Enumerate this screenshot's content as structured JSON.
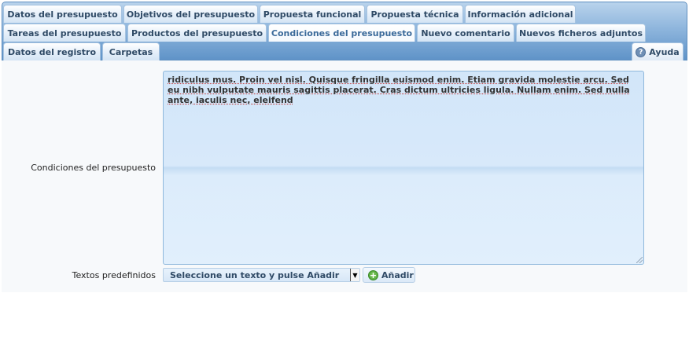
{
  "tabs": {
    "row1": [
      {
        "label": "Datos del presupuesto"
      },
      {
        "label": "Objetivos del presupuesto"
      },
      {
        "label": "Propuesta funcional"
      },
      {
        "label": "Propuesta técnica"
      },
      {
        "label": "Información adicional"
      }
    ],
    "row2": [
      {
        "label": "Tareas del presupuesto"
      },
      {
        "label": "Productos del presupuesto"
      },
      {
        "label": "Condiciones del presupuesto"
      },
      {
        "label": "Nuevo comentario"
      },
      {
        "label": "Nuevos ficheros adjuntos"
      }
    ],
    "row3": [
      {
        "label": "Datos del registro"
      },
      {
        "label": "Carpetas"
      }
    ],
    "active": "Condiciones del presupuesto",
    "help_label": "Ayuda",
    "help_icon": "question-icon"
  },
  "form": {
    "conditions_label": "Condiciones del presupuesto",
    "conditions_value": "ridiculus mus. Proin vel nisl. Quisque fringilla euismod enim. Etiam gravida molestie arcu. Sed eu nibh vulputate mauris sagittis placerat. Cras dictum ultricies ligula. Nullam enim. Sed nulla ante, iaculis nec, eleifend",
    "predefined_label": "Textos predefinidos",
    "predefined_selected": "Seleccione un texto y pulse Añadir",
    "add_label": "Añadir",
    "add_icon": "plus-icon"
  },
  "colors": {
    "tabbar": "#8fb6dd",
    "textarea_bg": "#d8e9fa",
    "add_icon": "#3f9a2a"
  }
}
